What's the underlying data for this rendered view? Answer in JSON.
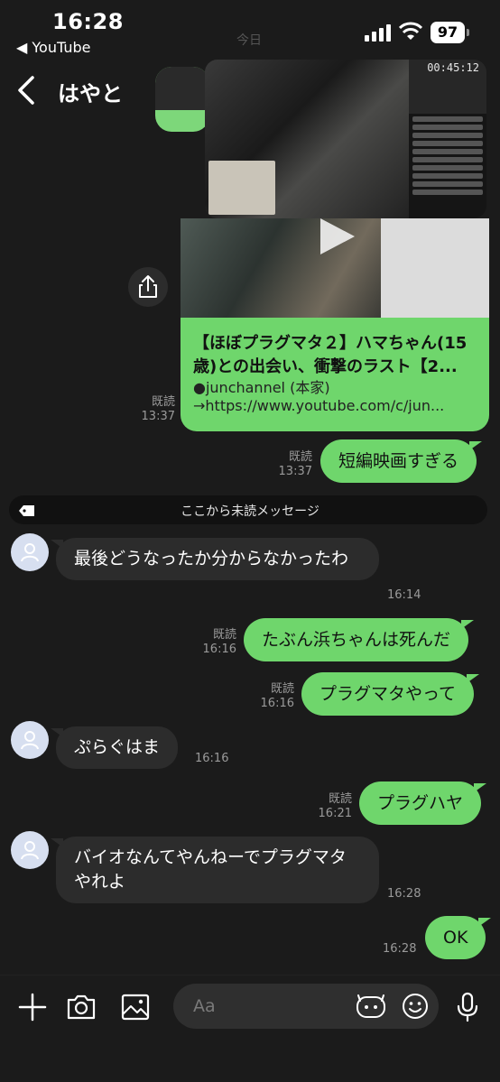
{
  "status_bar": {
    "time": "16:28",
    "back_app": "◀ YouTube",
    "battery": "97"
  },
  "header": {
    "title": "はやと",
    "date_label": "今日"
  },
  "video_pip": {
    "timer": "00:45:12"
  },
  "youtube_card": {
    "title": "【ほぼプラグマタ２】ハマちゃん(15歳)との出会い、衝撃のラスト【2...",
    "channel": "●junchannel (本家)",
    "url": "→https://www.youtube.com/c/jun..."
  },
  "messages": [
    {
      "id": "m1",
      "dir": "out",
      "read": "既読",
      "time": "13:37"
    },
    {
      "id": "m2",
      "dir": "out",
      "text": "短編映画すぎる",
      "read": "既読",
      "time": "13:37"
    },
    {
      "id": "m3",
      "dir": "in",
      "text": "最後どうなったか分からなかったわ",
      "time": "16:14"
    },
    {
      "id": "m4",
      "dir": "out",
      "text": "たぶん浜ちゃんは死んだ",
      "read": "既読",
      "time": "16:16"
    },
    {
      "id": "m5",
      "dir": "out",
      "text": "プラグマタやって",
      "read": "既読",
      "time": "16:16"
    },
    {
      "id": "m6",
      "dir": "in",
      "text": "ぷらぐはま",
      "time": "16:16"
    },
    {
      "id": "m7",
      "dir": "out",
      "text": "プラグハヤ",
      "read": "既読",
      "time": "16:21"
    },
    {
      "id": "m8",
      "dir": "in",
      "text": "バイオなんてやんねーでプラグマタやれよ",
      "time": "16:28"
    },
    {
      "id": "m9",
      "dir": "out",
      "text": "OK",
      "time": "16:28"
    }
  ],
  "unread_divider": "ここから未読メッセージ",
  "input": {
    "placeholder": "Aa"
  },
  "colors": {
    "accent_green": "#6fd66c",
    "background": "#1b1b1b",
    "incoming_bubble": "#2c2c2c"
  }
}
